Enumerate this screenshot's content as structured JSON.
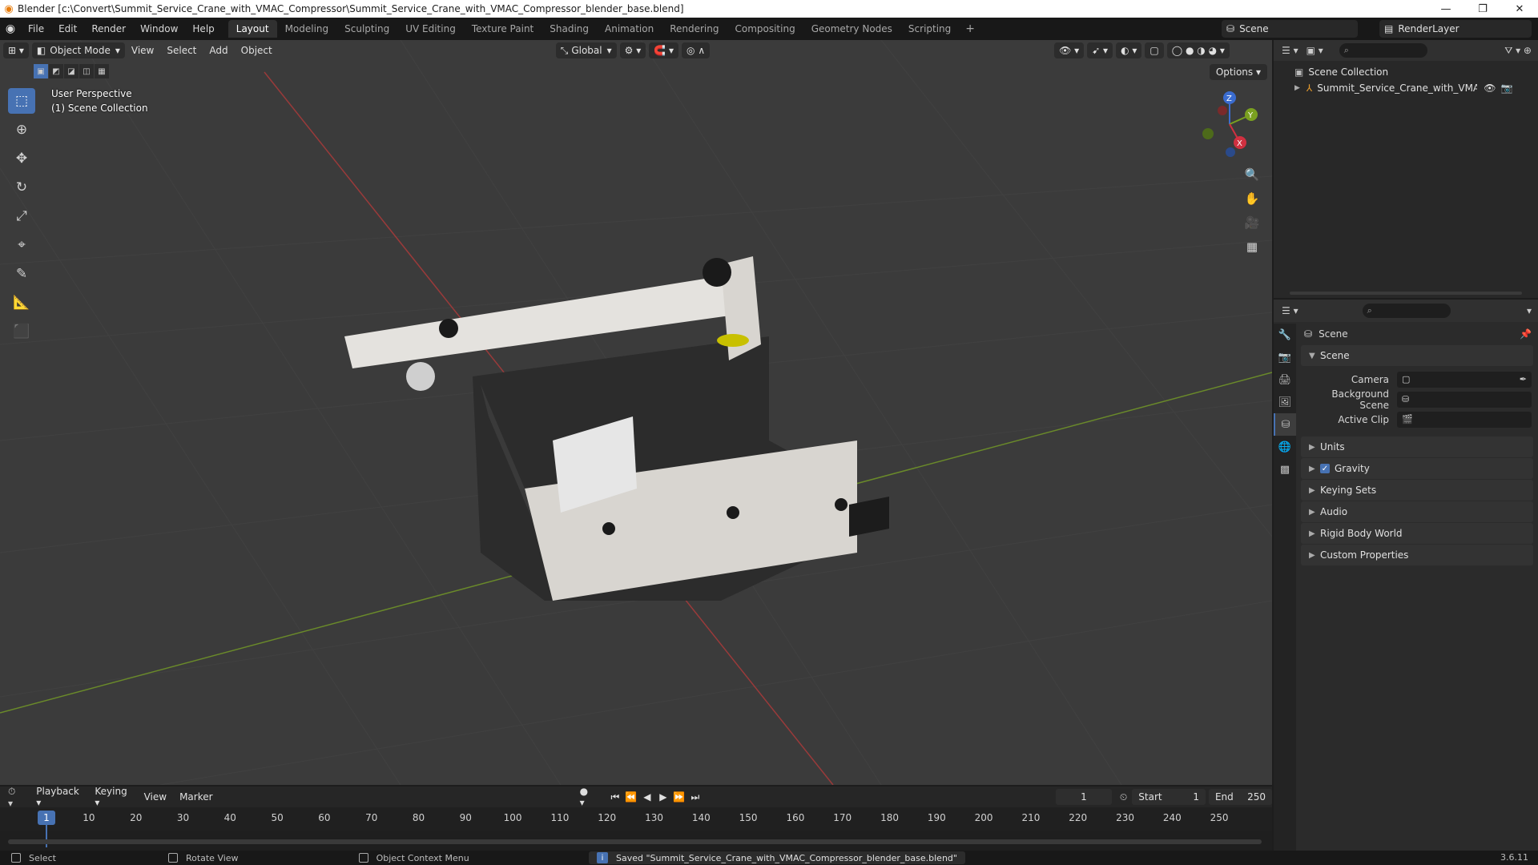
{
  "window": {
    "title": "Blender [c:\\Convert\\Summit_Service_Crane_with_VMAC_Compressor\\Summit_Service_Crane_with_VMAC_Compressor_blender_base.blend]"
  },
  "menubar": {
    "items": [
      "File",
      "Edit",
      "Render",
      "Window",
      "Help"
    ],
    "workspaces": [
      "Layout",
      "Modeling",
      "Sculpting",
      "UV Editing",
      "Texture Paint",
      "Shading",
      "Animation",
      "Rendering",
      "Compositing",
      "Geometry Nodes",
      "Scripting"
    ],
    "active_workspace": "Layout",
    "scene": "Scene",
    "view_layer": "RenderLayer"
  },
  "viewport": {
    "mode": "Object Mode",
    "menus": [
      "View",
      "Select",
      "Add",
      "Object"
    ],
    "transform_orientation": "Global",
    "options_label": "Options",
    "overlay_line1": "User Perspective",
    "overlay_line2": "(1) Scene Collection",
    "gizmo_axes": [
      "Z",
      "Y",
      "X"
    ]
  },
  "outliner": {
    "root": "Scene Collection",
    "items": [
      "Summit_Service_Crane_with_VMAC_Cor"
    ]
  },
  "properties": {
    "context": "Scene",
    "panel_title": "Scene",
    "fields": {
      "camera_label": "Camera",
      "background_label": "Background Scene",
      "active_clip_label": "Active Clip"
    },
    "panels": [
      "Units",
      "Gravity",
      "Keying Sets",
      "Audio",
      "Rigid Body World",
      "Custom Properties"
    ]
  },
  "timeline": {
    "menus": [
      "Playback",
      "Keying",
      "View",
      "Marker"
    ],
    "current_frame": "1",
    "start_label": "Start",
    "start": "1",
    "end_label": "End",
    "end": "250",
    "ticks": [
      "10",
      "20",
      "30",
      "40",
      "50",
      "60",
      "70",
      "80",
      "90",
      "100",
      "110",
      "120",
      "130",
      "140",
      "150",
      "160",
      "170",
      "180",
      "190",
      "200",
      "210",
      "220",
      "230",
      "240",
      "250"
    ]
  },
  "statusbar": {
    "select": "Select",
    "rotate": "Rotate View",
    "context_menu": "Object Context Menu",
    "message": "Saved \"Summit_Service_Crane_with_VMAC_Compressor_blender_base.blend\"",
    "version": "3.6.11"
  }
}
